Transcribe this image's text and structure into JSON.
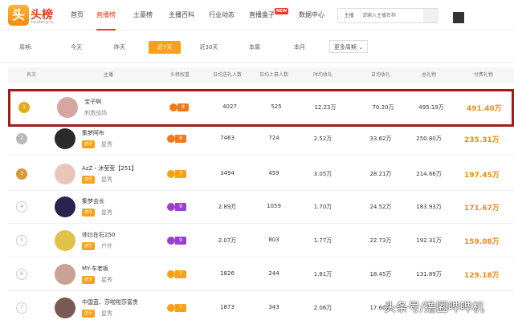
{
  "logo": {
    "badge": "头",
    "text": "头榜",
    "sub": "toubang.tv"
  },
  "nav": [
    {
      "label": "首页"
    },
    {
      "label": "直播榜"
    },
    {
      "label": "土豪榜"
    },
    {
      "label": "主播百科"
    },
    {
      "label": "行业动态"
    },
    {
      "label": "直播盒子"
    },
    {
      "label": "数据中心"
    }
  ],
  "nav_new_badge": "NEW",
  "search": {
    "select": "主播",
    "placeholder": "请输入主播名称"
  },
  "period": {
    "label": "周期:",
    "options": [
      "今天",
      "昨天",
      "近7天",
      "近30天",
      "本周",
      "本月"
    ],
    "active": "近7天",
    "more": "更多周期"
  },
  "table": {
    "headers": [
      "名次",
      "主播",
      "头榜权重",
      "日均送礼人数",
      "日均土豪人数",
      "时均收礼",
      "日均收礼",
      "总礼物",
      "付费礼物"
    ],
    "rows": [
      {
        "rank": "1",
        "name": "宝子啊",
        "tag": "",
        "category": "刺激战场",
        "weight": "8",
        "weight_color": "#f07a1a",
        "givers": "4027",
        "tycoons": "525",
        "hourly": "12.23万",
        "daily": "70.20万",
        "total": "495.19万",
        "paid": "491.40万"
      },
      {
        "rank": "2",
        "name": "集梦阿布",
        "tag": "虎牙",
        "category": "星秀",
        "weight": "8",
        "weight_color": "#f07a1a",
        "givers": "7463",
        "tycoons": "724",
        "hourly": "2.52万",
        "daily": "33.62万",
        "total": "250.80万",
        "paid": "235.31万"
      },
      {
        "rank": "3",
        "name": "AzZ・沐莹莹【251】",
        "tag": "虎牙",
        "category": "星秀",
        "weight": "7",
        "weight_color": "#f7a11a",
        "givers": "3494",
        "tycoons": "459",
        "hourly": "3.05万",
        "daily": "28.21万",
        "total": "214.66万",
        "paid": "197.45万"
      },
      {
        "rank": "4",
        "name": "集梦会长",
        "tag": "虎牙",
        "category": "星秀",
        "weight": "9",
        "weight_color": "#9a3fd0",
        "givers": "2.89万",
        "tycoons": "1059",
        "hourly": "1.70万",
        "daily": "24.52万",
        "total": "183.93万",
        "paid": "171.67万"
      },
      {
        "rank": "5",
        "name": "帅比在石250",
        "tag": "虎牙",
        "category": "户外",
        "weight": "9",
        "weight_color": "#9a3fd0",
        "givers": "2.07万",
        "tycoons": "803",
        "hourly": "1.77万",
        "daily": "22.73万",
        "total": "192.31万",
        "paid": "159.08万"
      },
      {
        "rank": "6",
        "name": "MY-车老板",
        "tag": "虎牙",
        "category": "星秀",
        "weight": "7",
        "weight_color": "#f7a11a",
        "givers": "1826",
        "tycoons": "244",
        "hourly": "1.81万",
        "daily": "18.45万",
        "total": "131.89万",
        "paid": "129.18万"
      },
      {
        "rank": "7",
        "name": "中国蓝、莎啦啦莎富贵",
        "tag": "虎牙",
        "category": "星秀",
        "weight": "7",
        "weight_color": "#f7a11a",
        "givers": "1873",
        "tycoons": "343",
        "hourly": "2.06万",
        "daily": "17.60万",
        "total": "",
        "paid": ""
      }
    ]
  },
  "watermark": "头条号/撸圈哔哔机",
  "colors": {
    "accent": "#f7a11a",
    "brand_red": "#e0401c",
    "highlight_border": "#a01a1a",
    "gift_orange": "#f08c10"
  }
}
